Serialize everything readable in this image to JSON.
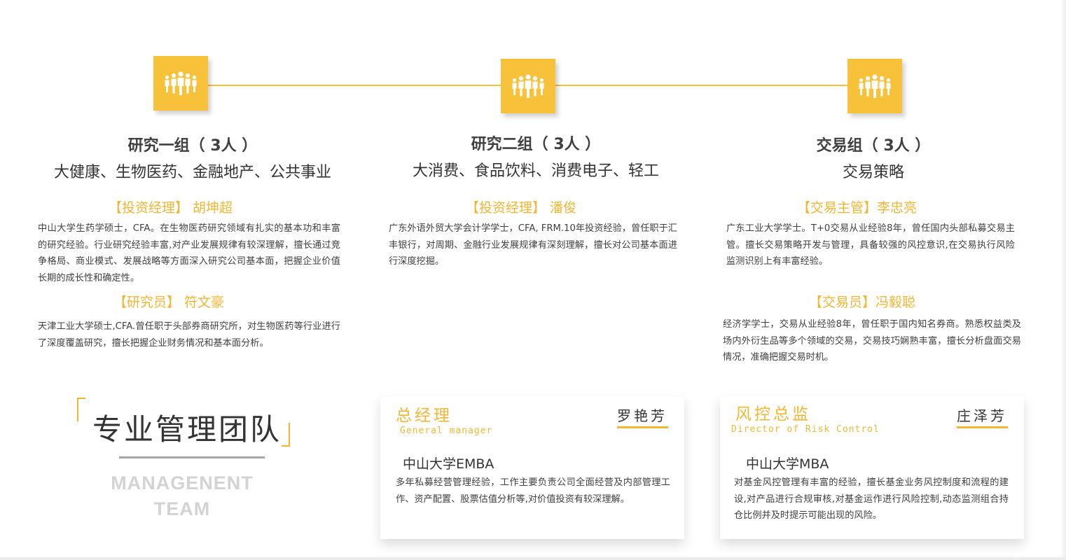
{
  "accent_color": "#f2b632",
  "groups": [
    {
      "icon": "people-group-icon",
      "title": "研究一组（ 3人 ）",
      "subtitle": "大健康、生物医药、金融地产、公共事业",
      "members": [
        {
          "role": "【投资经理】 胡坤超",
          "bio": "中山大学生药学硕士，CFA。在生物医药研究领域有扎实的基本功和丰富的研究经验。行业研究经验丰富,对产业发展规律有较深理解，擅长通过竞争格局、商业模式、发展战略等方面深入研究公司基本面，把握企业价值长期的成长性和确定性。"
        },
        {
          "role": "【研究员】 符文豪",
          "bio": "天津工业大学硕士,CFA.曾任职于头部券商研究所，对生物医药等行业进行了深度覆盖研究，擅长把握企业财务情况和基本面分析。"
        }
      ]
    },
    {
      "icon": "people-group-icon",
      "title": "研究二组（ 3人 ）",
      "subtitle": "大消费、食品饮料、消费电子、轻工",
      "members": [
        {
          "role": "【投资经理】 潘俊",
          "bio": "广东外语外贸大学会计学学士，CFA, FRM.10年投资经验，曾任职于汇丰银行，对周期、金融行业发展规律有深刻理解，擅长对公司基本面进行深度挖掘。"
        }
      ]
    },
    {
      "icon": "people-group-icon",
      "title": "交易组（ 3人 ）",
      "subtitle": "交易策略",
      "members": [
        {
          "role": "【交易主管】李忠亮",
          "bio": "广东工业大学学士。T+0交易从业经验8年，曾任国内头部私募交易主管。擅长交易策略开发与管理，具备较强的风控意识,在交易执行风险监测识别上有丰富经验。"
        },
        {
          "role": "【交易员】冯毅聪",
          "bio": "经济学学士，交易从业经验8年，曾任职于国内知名券商。熟悉权益类及场内外衍生品等多个领域的交易，交易技巧娴熟丰富，擅长分析盘面交易情况，准确把握交易时机。"
        }
      ]
    }
  ],
  "management": {
    "title": "专业管理团队",
    "title_en": "MANAGENENT TEAM"
  },
  "cards": [
    {
      "title": "总经理",
      "title_en": "General manager",
      "name": "罗艳芳",
      "degree": "中山大学EMBA",
      "bio": "多年私募经营管理经验，工作主要负责公司全面经营及内部管理工作、资产配置、股票估值分析等,对价值投资有较深理解。"
    },
    {
      "title": "风控总监",
      "title_en": "Director of Risk Control",
      "name": "庄泽芳",
      "degree": "中山大学MBA",
      "bio": "对基金风控管理有丰富的经验，擅长基金业务风控制度和流程的建设,对产品进行合规审核,对基金运作进行风险控制,动态监测组合持仓比例并及时提示可能出现的风险。"
    }
  ]
}
